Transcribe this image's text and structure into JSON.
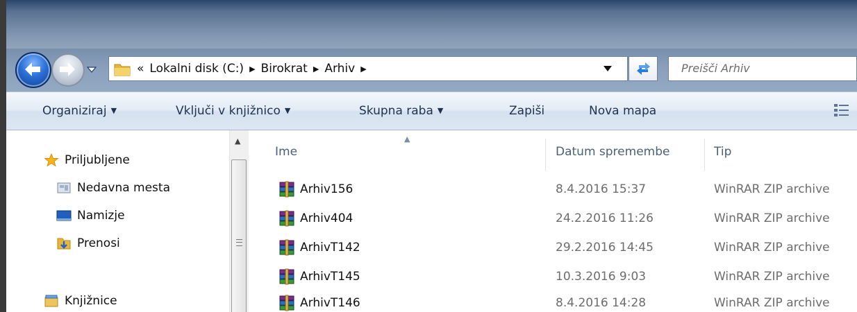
{
  "address": {
    "overflow_glyph": "«",
    "crumbs": [
      "Lokalni disk (C:)",
      "Birokrat",
      "Arhiv"
    ],
    "chevron": "▶"
  },
  "search": {
    "placeholder": "Preišči Arhiv"
  },
  "toolbar": {
    "organize": "Organiziraj",
    "include_library": "Vključi v knjižnico",
    "share": "Skupna raba",
    "burn": "Zapiši",
    "new_folder": "Nova mapa",
    "dropdown_glyph": "▼"
  },
  "navpane": {
    "favorites": "Priljubljene",
    "recent": "Nedavna mesta",
    "desktop": "Namizje",
    "downloads": "Prenosi",
    "libraries": "Knjižnice"
  },
  "columns": {
    "name": "Ime",
    "date": "Datum spremembe",
    "type": "Tip"
  },
  "files": [
    {
      "name": "Arhiv156",
      "date": "8.4.2016 15:37",
      "type": "WinRAR ZIP archive"
    },
    {
      "name": "Arhiv404",
      "date": "24.2.2016 11:26",
      "type": "WinRAR ZIP archive"
    },
    {
      "name": "ArhivT142",
      "date": "29.2.2016 14:45",
      "type": "WinRAR ZIP archive"
    },
    {
      "name": "ArhivT145",
      "date": "10.3.2016 9:03",
      "type": "WinRAR ZIP archive"
    },
    {
      "name": "ArhivT146",
      "date": "8.4.2016 14:28",
      "type": "WinRAR ZIP archive"
    }
  ]
}
